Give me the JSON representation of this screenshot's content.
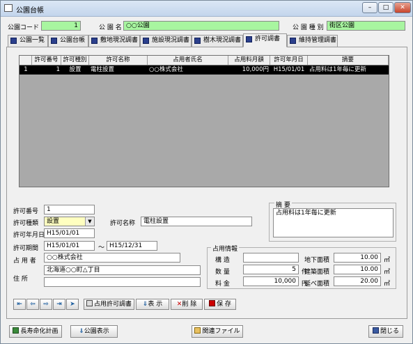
{
  "window": {
    "title": "公園台帳"
  },
  "header": {
    "park_code_label": "公園コード",
    "park_code_value": "1",
    "park_name_label": "公 園 名",
    "park_name_value": "○○公園",
    "park_type_label": "公 園 種 別",
    "park_type_value": "街区公園"
  },
  "tabs": [
    {
      "label": "公園一覧"
    },
    {
      "label": "公園台帳"
    },
    {
      "label": "敷地現況調書"
    },
    {
      "label": "施設現況調書"
    },
    {
      "label": "樹木現況調書"
    },
    {
      "label": "許可調書"
    },
    {
      "label": "維持管理調書"
    }
  ],
  "grid": {
    "columns": [
      "",
      "許可番号",
      "許可種別",
      "許可名称",
      "占用者氏名",
      "占用料月額",
      "許可年月日",
      "摘要"
    ],
    "rows": [
      [
        "1",
        "1",
        "設置",
        "電柱設置",
        "○○株式会社",
        "10,000円",
        "H15/01/01",
        "占用料は1年毎に更新"
      ]
    ]
  },
  "form": {
    "permit_no_label": "許可番号",
    "permit_no_value": "1",
    "permit_type_label": "許可種類",
    "permit_type_value": "設置",
    "permit_name_label": "許可名称",
    "permit_name_value": "電柱設置",
    "permit_date_label": "許可年月日",
    "permit_date_value": "H15/01/01",
    "permit_period_label": "許可期間",
    "period_from": "H15/01/01",
    "period_sep": "～",
    "period_to": "H15/12/31",
    "occupant_label": "占 用 者",
    "occupant_value": "○○株式会社",
    "address_label": "住 所",
    "address_value1": "北海道○○町△丁目",
    "address_value2": "",
    "remarks_label": "摘 要",
    "remarks_value": "占用料は1年毎に更新"
  },
  "occupancy": {
    "title": "占用情報",
    "structure_label": "構 造",
    "structure_value": "",
    "qty_label": "数 量",
    "qty_value": "5",
    "qty_unit": "件",
    "fee_label": "料 金",
    "fee_value": "10,000",
    "fee_unit": "円",
    "underground_label": "地下面積",
    "underground_value": "10.00",
    "building_label": "建築面積",
    "building_value": "10.00",
    "floor_label": "延べ面積",
    "floor_value": "20.00",
    "area_unit": "㎡"
  },
  "toolbar": {
    "print_label": "占用許可調書",
    "display_label": "表 示",
    "delete_label": "削 除",
    "save_label": "保 存"
  },
  "footer": {
    "longevity_label": "長寿命化計画",
    "park_display_label": "公園表示",
    "related_files_label": "関連ファイル",
    "close_label": "閉じる"
  }
}
